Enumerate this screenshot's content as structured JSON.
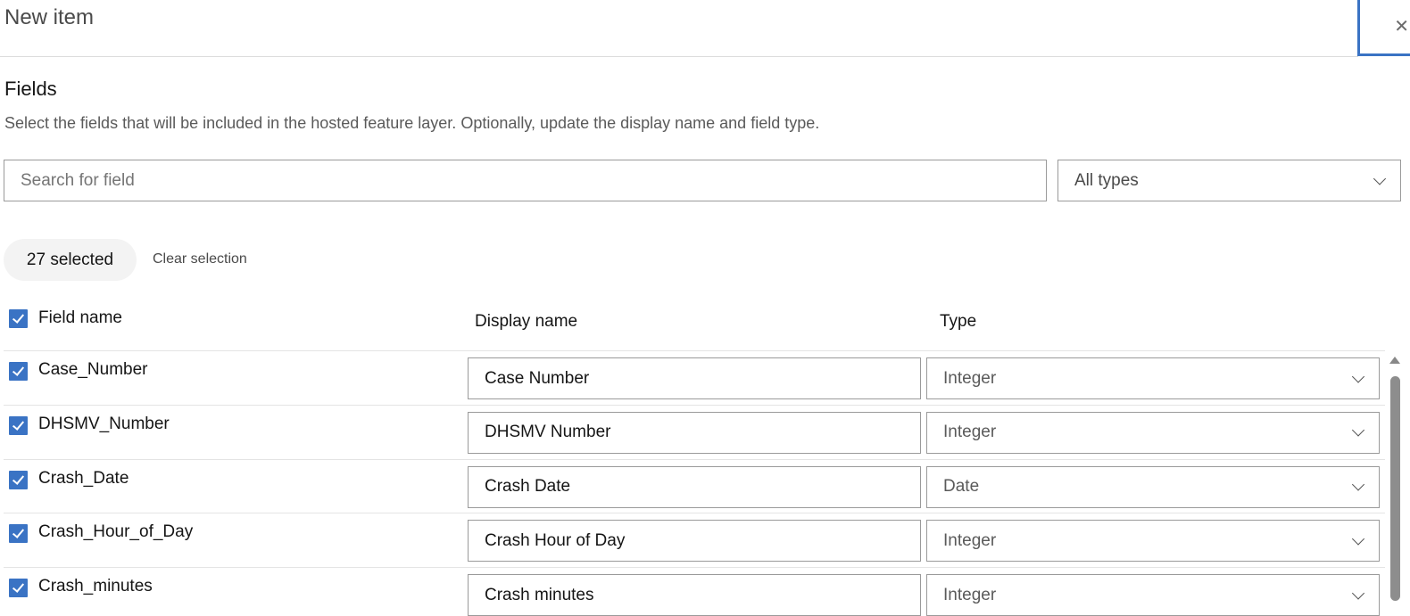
{
  "header": {
    "title": "New item",
    "close_icon": "close-icon"
  },
  "section": {
    "title": "Fields",
    "description": "Select the fields that will be included in the hosted feature layer. Optionally, update the display name and field type."
  },
  "search": {
    "placeholder": "Search for field",
    "value": ""
  },
  "type_filter": {
    "selected": "All types"
  },
  "selection": {
    "count_label": "27 selected",
    "clear_label": "Clear selection"
  },
  "columns": {
    "field_name": "Field name",
    "display_name": "Display name",
    "type": "Type"
  },
  "rows": [
    {
      "field": "Case_Number",
      "display": "Case Number",
      "type": "Integer",
      "checked": true
    },
    {
      "field": "DHSMV_Number",
      "display": "DHSMV Number",
      "type": "Integer",
      "checked": true
    },
    {
      "field": "Crash_Date",
      "display": "Crash Date",
      "type": "Date",
      "checked": true
    },
    {
      "field": "Crash_Hour_of_Day",
      "display": "Crash Hour of Day",
      "type": "Integer",
      "checked": true
    },
    {
      "field": "Crash_minutes",
      "display": "Crash minutes",
      "type": "Integer",
      "checked": true
    }
  ],
  "colors": {
    "accent": "#3a73c4"
  }
}
